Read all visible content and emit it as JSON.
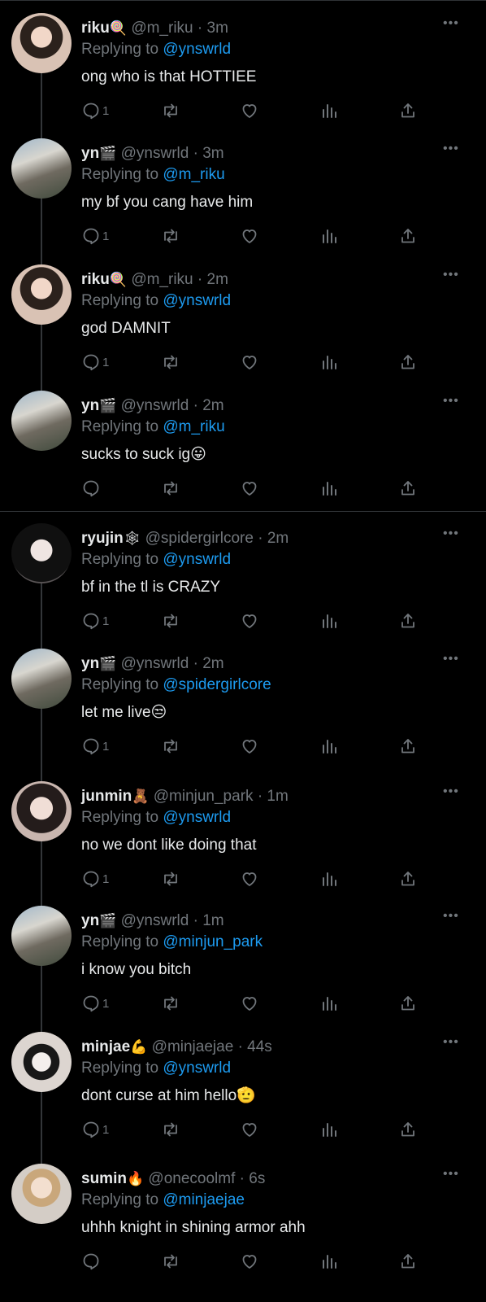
{
  "tweets": [
    {
      "name": "riku",
      "emoji": "🍭",
      "handle": "@m_riku",
      "time": "3m",
      "reply_prefix": "Replying to",
      "reply_to": "@ynswrld",
      "text": "ong who is that HOTTIEE",
      "reply_count": "1",
      "avatar": "riku"
    },
    {
      "name": "yn",
      "emoji": "🎬",
      "handle": "@ynswrld",
      "time": "3m",
      "reply_prefix": "Replying to",
      "reply_to": "@m_riku",
      "text": "my bf you cang have him",
      "reply_count": "1",
      "avatar": "yn"
    },
    {
      "name": "riku",
      "emoji": "🍭",
      "handle": "@m_riku",
      "time": "2m",
      "reply_prefix": "Replying to",
      "reply_to": "@ynswrld",
      "text": "god DAMNIT",
      "reply_count": "1",
      "avatar": "riku"
    },
    {
      "name": "yn",
      "emoji": "🎬",
      "handle": "@ynswrld",
      "time": "2m",
      "reply_prefix": "Replying to",
      "reply_to": "@m_riku",
      "text": "sucks to suck ig😛",
      "reply_count": "",
      "avatar": "yn"
    },
    {
      "name": "ryujin",
      "emoji": "🕸",
      "handle": "@spidergirlcore",
      "time": "2m",
      "reply_prefix": "Replying to",
      "reply_to": "@ynswrld",
      "text": "bf in the tl is CRAZY",
      "reply_count": "1",
      "avatar": "ryujin"
    },
    {
      "name": "yn",
      "emoji": "🎬",
      "handle": "@ynswrld",
      "time": "2m",
      "reply_prefix": "Replying to",
      "reply_to": "@spidergirlcore",
      "text": "let me live😒",
      "reply_count": "1",
      "avatar": "yn"
    },
    {
      "name": "junmin",
      "emoji": "🧸",
      "handle": "@minjun_park",
      "time": "1m",
      "reply_prefix": "Replying to",
      "reply_to": "@ynswrld",
      "text": "no we dont like doing that",
      "reply_count": "1",
      "avatar": "junmin"
    },
    {
      "name": "yn",
      "emoji": "🎬",
      "handle": "@ynswrld",
      "time": "1m",
      "reply_prefix": "Replying to",
      "reply_to": "@minjun_park",
      "text": "i know you bitch",
      "reply_count": "1",
      "avatar": "yn"
    },
    {
      "name": "minjae",
      "emoji": "💪",
      "handle": "@minjaejae",
      "time": "44s",
      "reply_prefix": "Replying to",
      "reply_to": "@ynswrld",
      "text": "dont curse at him hello🫡",
      "reply_count": "1",
      "avatar": "minjae"
    },
    {
      "name": "sumin",
      "emoji": "🔥",
      "handle": "@onecoolmf",
      "time": "6s",
      "reply_prefix": "Replying to",
      "reply_to": "@minjaejae",
      "text": "uhhh knight in shining armor ahh",
      "reply_count": "",
      "avatar": "sumin"
    }
  ],
  "ui": {
    "separator": "·",
    "more": "•••"
  },
  "colors": {
    "background": "#000000",
    "text": "#e7e9ea",
    "muted": "#71767b",
    "link": "#1d9bf0",
    "divider": "#2f3336"
  }
}
